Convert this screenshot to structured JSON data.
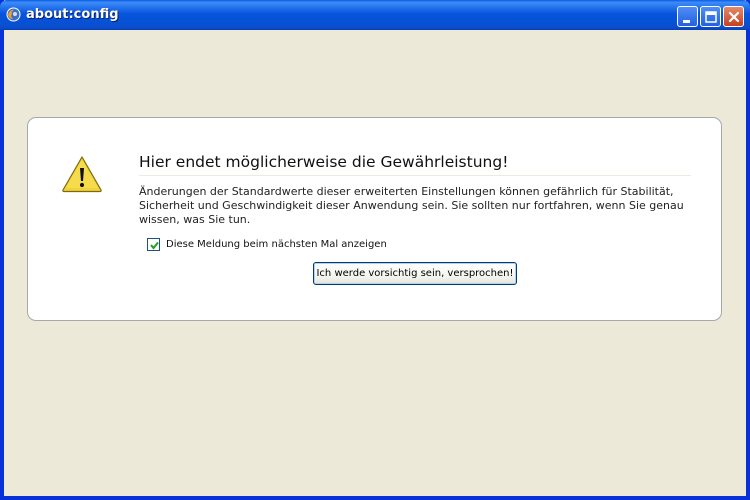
{
  "window": {
    "title": "about:config",
    "icon": "firefox-icon"
  },
  "titlebar_buttons": {
    "minimize": "minimize-icon",
    "maximize": "maximize-icon",
    "close": "close-icon"
  },
  "warning": {
    "icon": "warning-triangle-icon",
    "heading": "Hier endet möglicherweise die Gewährleistung!",
    "description": "Änderungen der Standardwerte dieser erweiterten Einstellungen können gefährlich für Stabilität, Sicherheit und Geschwindigkeit dieser Anwendung sein. Sie sollten nur fortfahren, wenn Sie genau wissen, was Sie tun.",
    "checkbox_label": "Diese Meldung beim nächsten Mal anzeigen",
    "checkbox_checked": true,
    "button_label": "Ich werde vorsichtig sein, versprochen!"
  },
  "colors": {
    "titlebar": "#0855dd",
    "window_bg": "#ece9d8",
    "warning_yellow": "#f2d23a"
  }
}
